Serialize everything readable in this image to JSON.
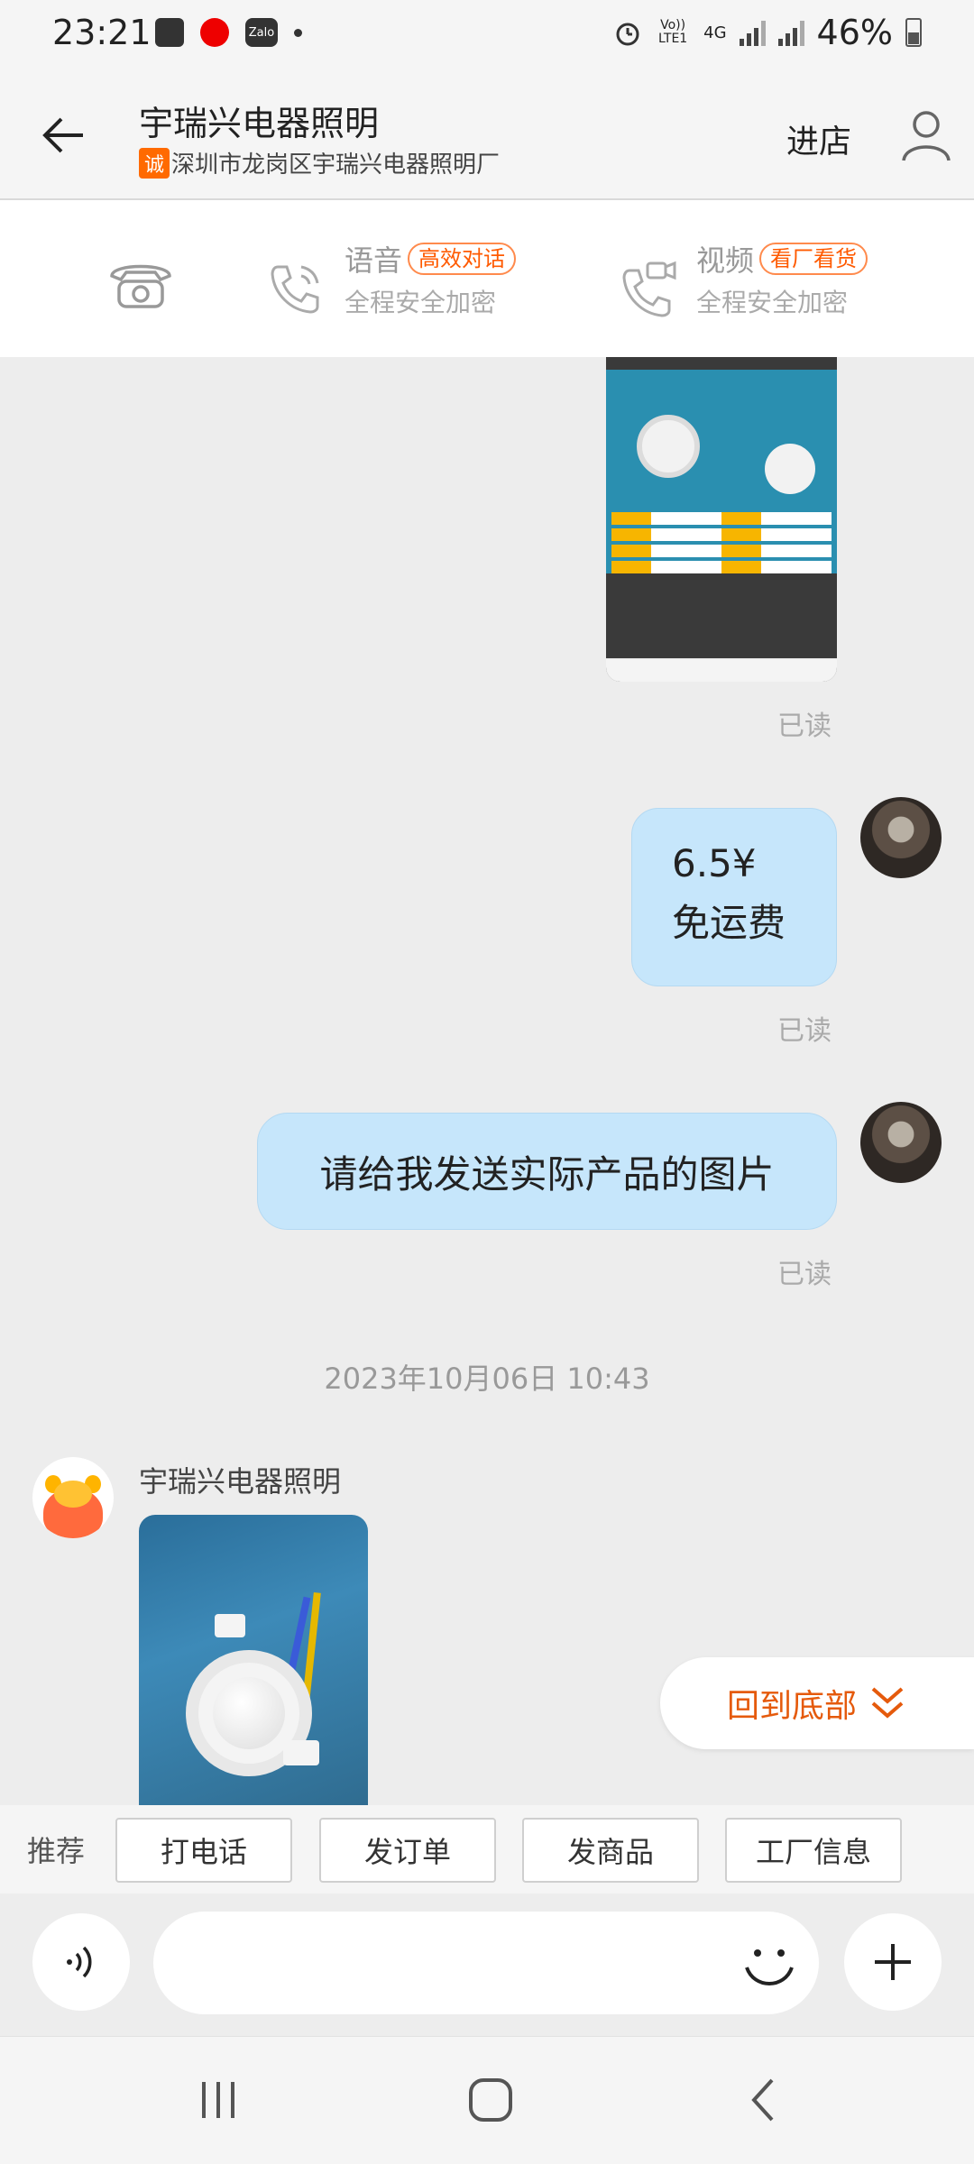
{
  "status_bar": {
    "time": "23:21",
    "notification_icons": [
      "gallery-icon",
      "youtube-icon",
      "zalo-icon",
      "dot-icon"
    ],
    "zalo_label": "Zalo",
    "volte_label": "Vo)) LTE1",
    "network_label": "4G",
    "battery_percent": "46%",
    "battery_level": 0.46
  },
  "header": {
    "title": "宇瑞兴电器照明",
    "subtitle_badge": "诚",
    "subtitle": "深圳市龙岗区宇瑞兴电器照明厂",
    "enter_store_label": "进店"
  },
  "call_bar": {
    "voice": {
      "label": "语音",
      "tag": "高效对话",
      "desc": "全程安全加密"
    },
    "video": {
      "label": "视频",
      "tag": "看厂看货",
      "desc": "全程安全加密"
    }
  },
  "messages": [
    {
      "type": "image",
      "from": "me",
      "read_label": "已读"
    },
    {
      "type": "text",
      "from": "me",
      "lines": [
        "6.5¥",
        "免运费"
      ],
      "read_label": "已读"
    },
    {
      "type": "text",
      "from": "me",
      "text": "请给我发送实际产品的图片",
      "read_label": "已读"
    },
    {
      "type": "timestamp",
      "text": "2023年10月06日 10:43"
    },
    {
      "type": "image",
      "from": "shop",
      "sender": "宇瑞兴电器照明"
    }
  ],
  "back_to_bottom_label": "回到底部",
  "recommend": {
    "label": "推荐",
    "buttons": [
      "打电话",
      "发订单",
      "发商品",
      "工厂信息"
    ]
  },
  "input": {
    "placeholder": ""
  },
  "colors": {
    "accent": "#e55a0c",
    "bubble_me": "#c6e6fb",
    "background": "#ededed"
  }
}
